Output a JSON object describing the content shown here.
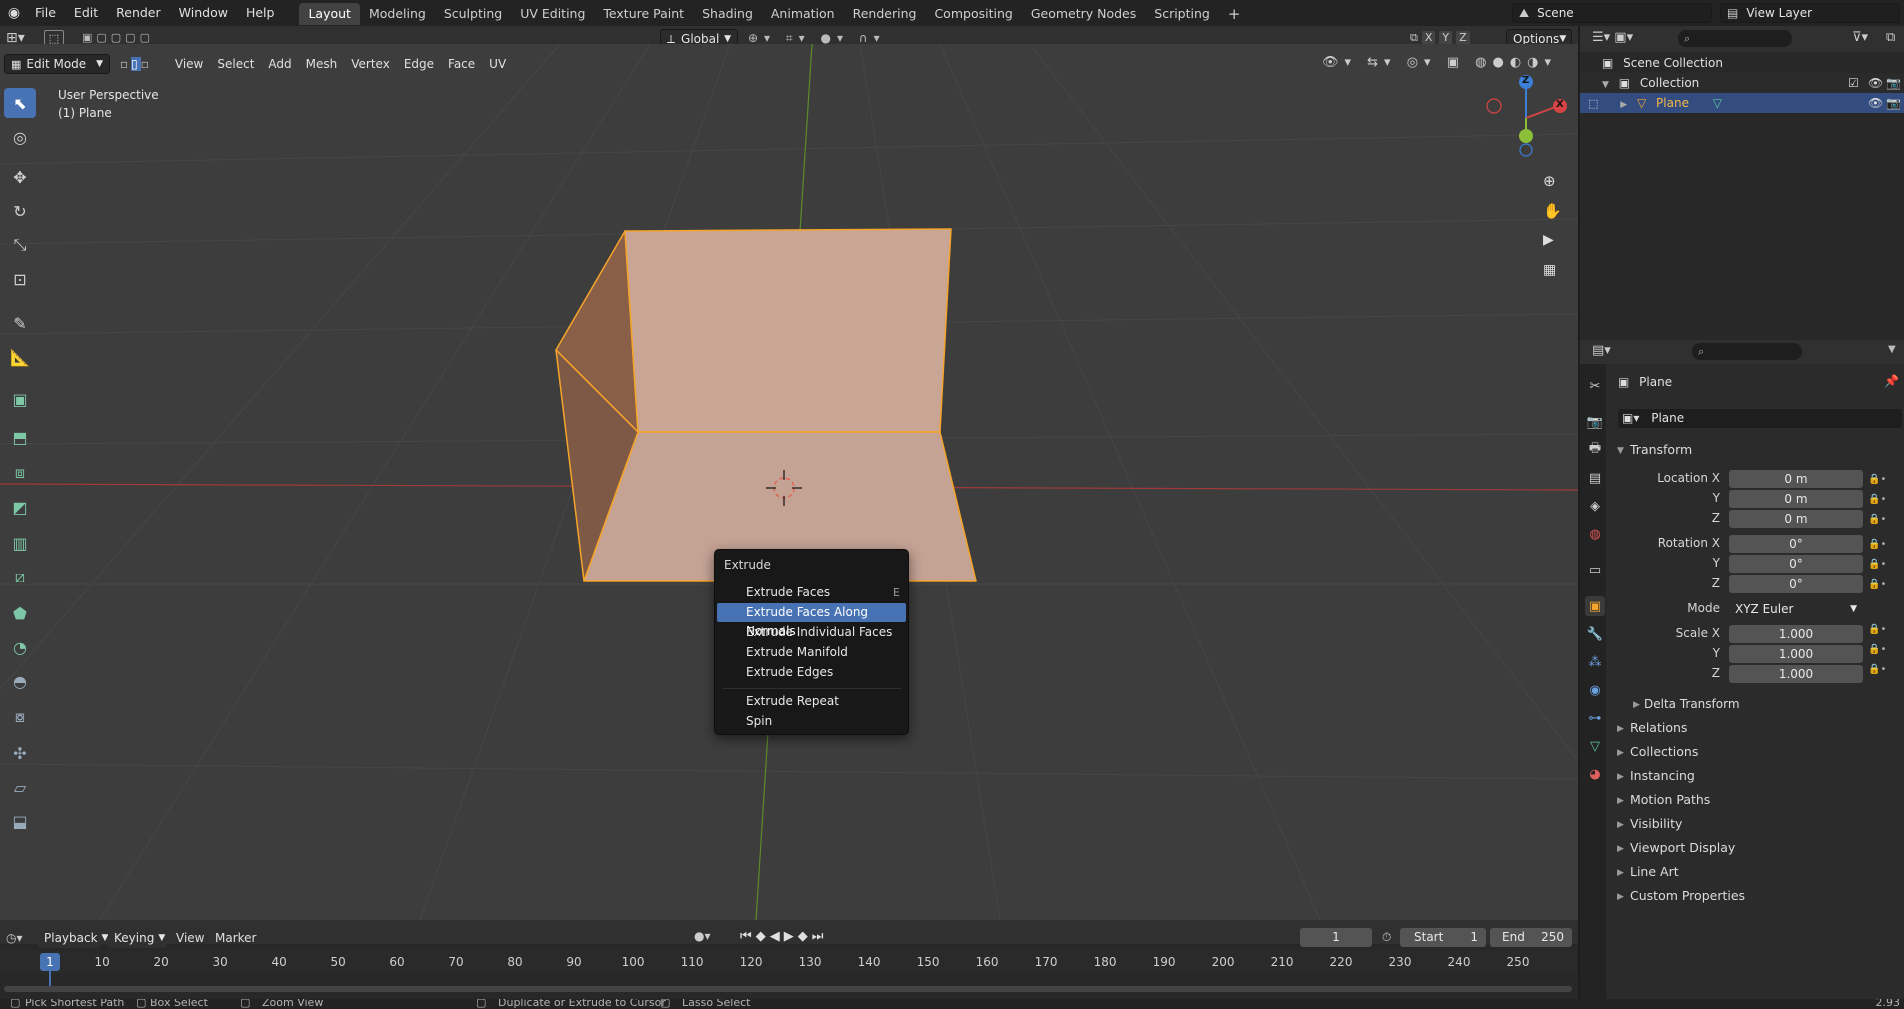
{
  "topbar": {
    "menus": [
      "File",
      "Edit",
      "Render",
      "Window",
      "Help"
    ],
    "workspaces": [
      "Layout",
      "Modeling",
      "Sculpting",
      "UV Editing",
      "Texture Paint",
      "Shading",
      "Animation",
      "Rendering",
      "Compositing",
      "Geometry Nodes",
      "Scripting"
    ],
    "active_workspace": "Layout",
    "add_tab": "+",
    "scene": "Scene",
    "view_layer": "View Layer"
  },
  "tool_header": {
    "orientation": "Global",
    "options": "Options",
    "axes": [
      "X",
      "Y",
      "Z"
    ]
  },
  "viewport_header": {
    "mode": "Edit Mode",
    "menus": [
      "View",
      "Select",
      "Add",
      "Mesh",
      "Vertex",
      "Edge",
      "Face",
      "UV"
    ]
  },
  "viewport": {
    "perspective": "User Perspective",
    "object": "(1) Plane",
    "gizmo_axes": [
      "Z",
      "X"
    ]
  },
  "extrude_menu": {
    "title": "Extrude",
    "items": [
      {
        "label": "Extrude Faces",
        "shortcut": "E",
        "highlighted": false
      },
      {
        "label": "Extrude Faces Along Normals",
        "shortcut": "",
        "highlighted": true
      },
      {
        "label": "Extrude Individual Faces",
        "shortcut": "",
        "highlighted": false
      },
      {
        "label": "Extrude Manifold",
        "shortcut": "",
        "highlighted": false
      },
      {
        "label": "Extrude Edges",
        "shortcut": "",
        "highlighted": false
      }
    ],
    "items2": [
      {
        "label": "Extrude Repeat"
      },
      {
        "label": "Spin"
      }
    ]
  },
  "outliner": {
    "scene_collection": "Scene Collection",
    "collection": "Collection",
    "object": "Plane"
  },
  "properties": {
    "object_name": "Plane",
    "data_name": "Plane",
    "transform_header": "Transform",
    "location": {
      "label": "Location X",
      "x": "0 m",
      "y": "0 m",
      "z": "0 m"
    },
    "rotation": {
      "label": "Rotation X",
      "x": "0°",
      "y": "0°",
      "z": "0°"
    },
    "mode_label": "Mode",
    "mode_value": "XYZ Euler",
    "scale": {
      "label": "Scale X",
      "x": "1.000",
      "y": "1.000",
      "z": "1.000"
    },
    "y_label": "Y",
    "z_label": "Z",
    "delta_transform": "Delta Transform",
    "panels": [
      "Relations",
      "Collections",
      "Instancing",
      "Motion Paths",
      "Visibility",
      "Viewport Display",
      "Line Art",
      "Custom Properties"
    ]
  },
  "timeline": {
    "menus": [
      "Playback",
      "Keying",
      "View",
      "Marker"
    ],
    "current_frame": "1",
    "start_label": "Start",
    "start": "1",
    "end_label": "End",
    "end": "250",
    "ticks": [
      "1",
      "10",
      "20",
      "30",
      "40",
      "50",
      "60",
      "70",
      "80",
      "90",
      "100",
      "110",
      "120",
      "130",
      "140",
      "150",
      "160",
      "170",
      "180",
      "190",
      "200",
      "210",
      "220",
      "230",
      "240",
      "250"
    ]
  },
  "statusbar": {
    "items": [
      "Pick Shortest Path",
      "Box Select",
      "Zoom View",
      "Duplicate or Extrude to Cursor",
      "Lasso Select"
    ],
    "version": "2.93"
  },
  "colors": {
    "accent": "#4772b3",
    "selection_orange": "#f5a42a",
    "face_fill": "#c9a596",
    "x_axis": "#d64545",
    "y_axis": "#8bbf3a",
    "z_axis": "#3c7fd6"
  }
}
